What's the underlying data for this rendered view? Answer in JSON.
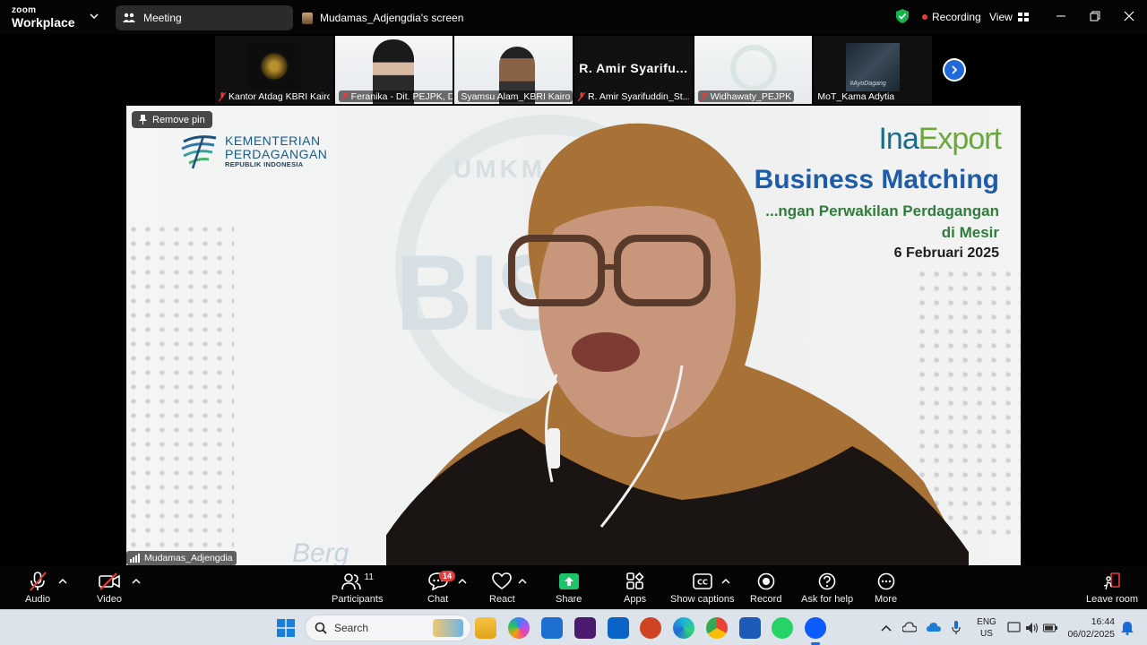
{
  "app": {
    "brand_top": "zoom",
    "brand_bottom": "Workplace"
  },
  "tabs": {
    "meeting": "Meeting",
    "screen": "Mudamas_Adjengdia's screen"
  },
  "titlebar": {
    "recording": "Recording",
    "view": "View"
  },
  "participants_strip": [
    {
      "name": "Kantor Atdag KBRI Kairo",
      "muted": true
    },
    {
      "name": "Feranika - Dit. PEJPK, D...",
      "muted": true
    },
    {
      "name": "Syamsu Alam_KBRI Kairo",
      "muted": false
    },
    {
      "name": "R. Amir Syarifuddin_St...",
      "big_label": "R. Amir Syarifu...",
      "muted": true
    },
    {
      "name": "Widhawaty_PEJPK",
      "muted": true
    },
    {
      "name": "MoT_Kama Adytia",
      "overlay": "#AyoDagang",
      "muted": false
    }
  ],
  "main_video": {
    "remove_pin": "Remove pin",
    "speaker": "Mudamas_Adjengdia",
    "slide": {
      "ministry_line1": "KEMENTERIAN",
      "ministry_line2": "PERDAGANGAN",
      "ministry_line3": "REPUBLIK INDONESIA",
      "brand_a": "Ina",
      "brand_b": "Export",
      "title": "Business Matching",
      "subtitle1": "...ngan Perwakilan Perdagangan",
      "subtitle2": "di Mesir",
      "date": "6 Februari 2025",
      "watermark_top": "UMKM",
      "watermark_mid": "BISA",
      "watermark_bottom": "Berg"
    }
  },
  "toolbar": {
    "audio": "Audio",
    "video": "Video",
    "participants": "Participants",
    "participants_count": "11",
    "chat": "Chat",
    "chat_badge": "14",
    "react": "React",
    "share": "Share",
    "apps": "Apps",
    "captions": "Show captions",
    "record": "Record",
    "help": "Ask for help",
    "more": "More",
    "leave": "Leave room"
  },
  "taskbar": {
    "search_placeholder": "Search",
    "lang_line1": "ENG",
    "lang_line2": "US",
    "time": "16:44",
    "date": "06/02/2025"
  },
  "colors": {
    "accent_blue": "#1f6ad8",
    "share_green": "#1ec26b",
    "record_red": "#e83b3b",
    "shield_green": "#19b34d"
  }
}
